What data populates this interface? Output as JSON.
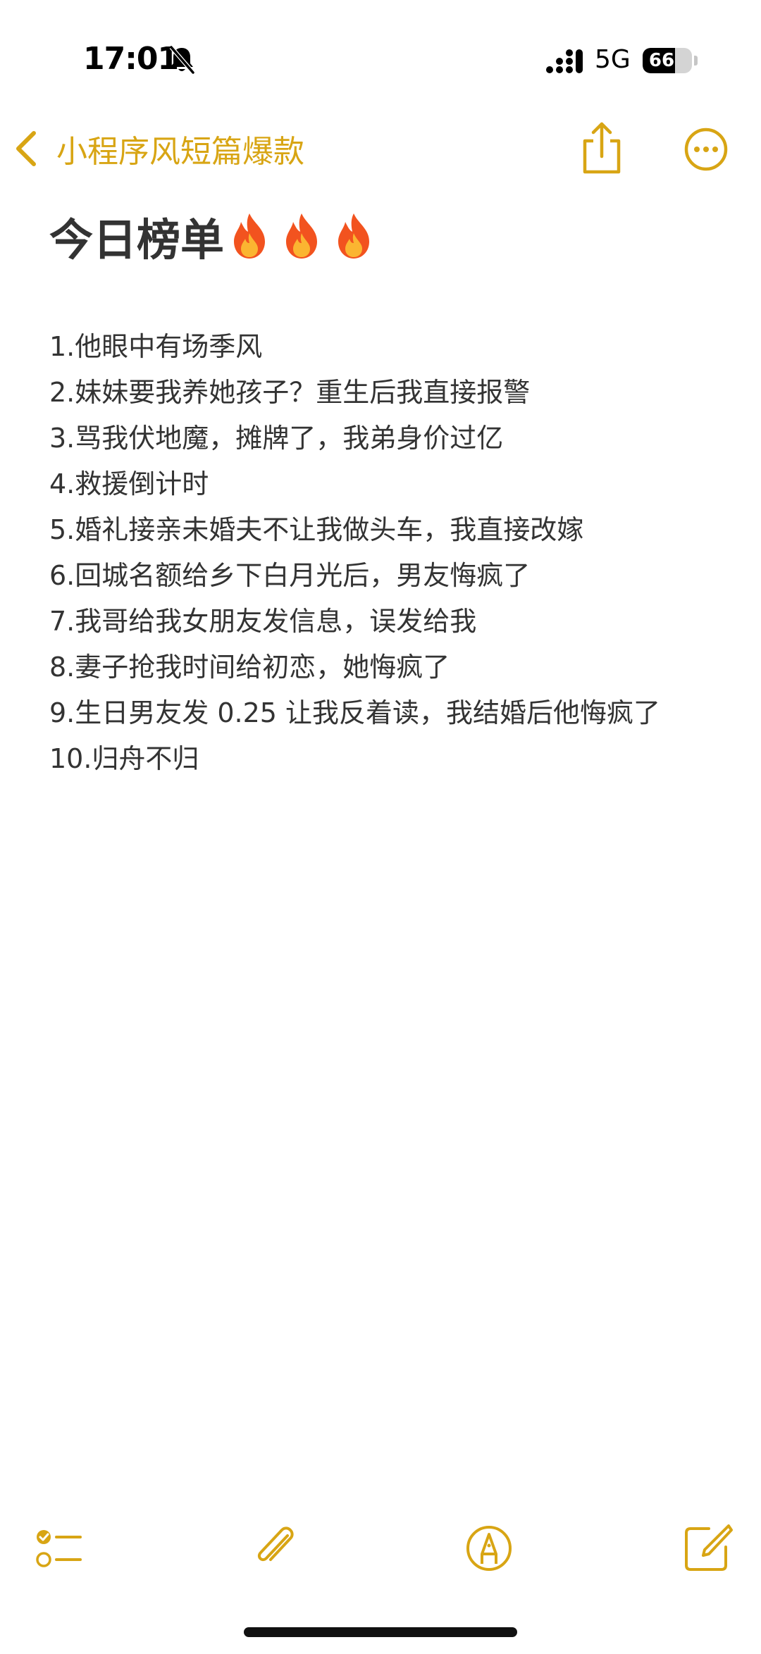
{
  "status_bar": {
    "time": "17:01",
    "network": "5G",
    "battery_level": "66",
    "battery_fraction": 0.66,
    "icons": [
      "bell-off-icon",
      "signal-icon",
      "battery-icon"
    ]
  },
  "nav": {
    "back_label": "小程序风短篇爆款",
    "back_icon": "chevron-left-icon",
    "share_icon": "share-icon",
    "more_icon": "ellipsis-circle-icon",
    "accent_color": "#d8a514"
  },
  "note": {
    "title": "今日榜单",
    "title_emoji_icons": [
      "fire-icon",
      "fire-icon",
      "fire-icon"
    ],
    "items": [
      "1.他眼中有场季风",
      "2.妹妹要我养她孩子？重生后我直接报警",
      "3.骂我伏地魔，摊牌了，我弟身价过亿",
      "4.救援倒计时",
      "5.婚礼接亲未婚夫不让我做头车，我直接改嫁",
      "6.回城名额给乡下白月光后，男友悔疯了",
      "7.我哥给我女朋友发信息，误发给我",
      "8.妻子抢我时间给初恋，她悔疯了",
      "9.生日男友发 0.25 让我反着读，我结婚后他悔疯了",
      "10.归舟不归"
    ]
  },
  "toolbar": {
    "icons": [
      "checklist-icon",
      "paperclip-icon",
      "markup-pen-icon",
      "compose-icon"
    ]
  }
}
